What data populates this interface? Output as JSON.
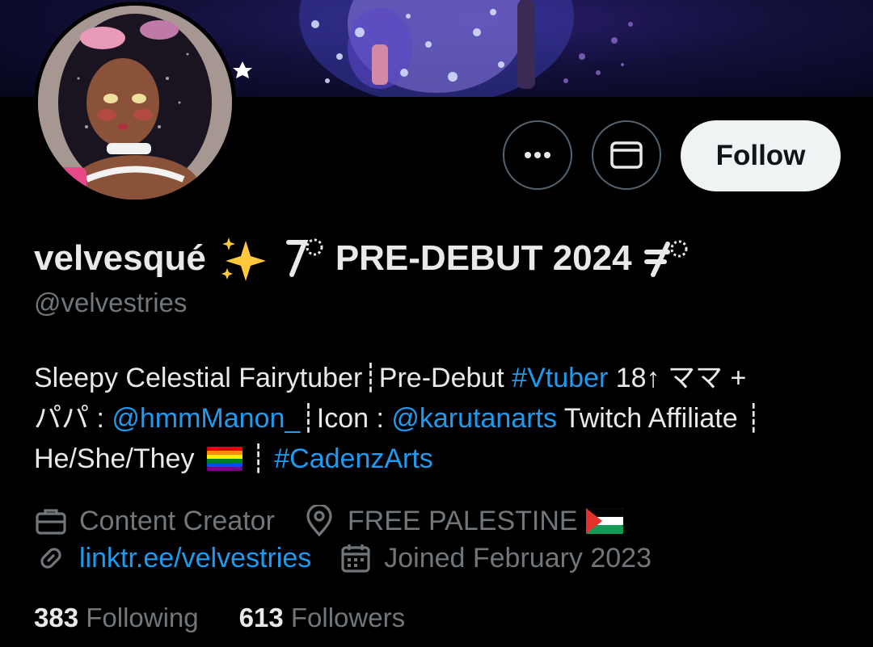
{
  "profile": {
    "display_name": "velvesqué",
    "name_suffix": "PRE-DEBUT 2024",
    "handle": "@velvestries",
    "follow_label": "Follow",
    "bio": {
      "t1": "Sleepy Celestial Fairytuber",
      "sep1": "┊",
      "t2": "Pre-Debut ",
      "tag_vtuber": "#Vtuber",
      "t3": " 18↑ ママ +",
      "t4": "パパ : ",
      "mention_manon": "@hmmManon_",
      "t5": "┊Icon : ",
      "mention_karuta": "@karutanarts",
      "t6": " Twitch Affiliate ┊",
      "t7": "He/She/They ",
      "t8": " ┊ ",
      "tag_cadenz": "#CadenzArts"
    },
    "category": "Content Creator",
    "location": "FREE PALESTINE",
    "website": "linktr.ee/velvestries",
    "joined": "Joined February 2023",
    "following_count": "383",
    "following_label": " Following",
    "followers_count": "613",
    "followers_label": " Followers"
  },
  "icons": {
    "more": "more-dots-icon",
    "message": "envelope-icon",
    "category": "briefcase-icon",
    "location": "location-pin-icon",
    "website": "link-icon",
    "joined": "calendar-icon"
  },
  "colors": {
    "background": "#000000",
    "text": "#e7e9ea",
    "muted": "#71767b",
    "link": "#1d9bf0",
    "follow_bg": "#eff3f4"
  }
}
